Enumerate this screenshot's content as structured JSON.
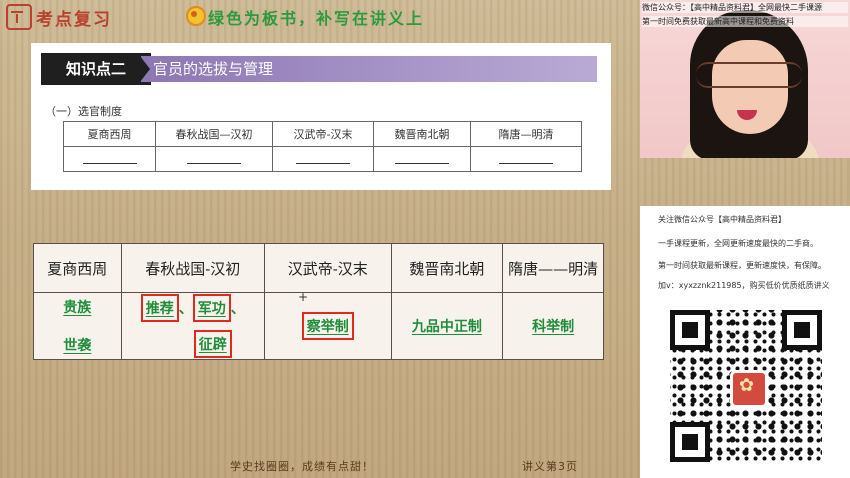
{
  "topbar": {
    "brand": "考点复习",
    "headline": "绿色为板书，补写在讲义上"
  },
  "card": {
    "tag": "知识点二",
    "title": "官员的选拔与管理",
    "subtitle": "（一）选官制度",
    "headers": [
      "夏商西周",
      "春秋战国—汉初",
      "汉武帝-汉末",
      "魏晋南北朝",
      "隋唐—明清"
    ]
  },
  "board": {
    "headers": [
      "夏商西周",
      "春秋战国-汉初",
      "汉武帝-汉末",
      "魏晋南北朝",
      "隋唐——明清"
    ],
    "col1": [
      "贵族",
      "世袭"
    ],
    "col2": [
      "推荐",
      "、",
      "军功",
      "、",
      "征辟"
    ],
    "col3": "察举制",
    "col4": "九品中正制",
    "col5": "科举制"
  },
  "bottom": {
    "left": "学史找圈圈，成绩有点甜！",
    "right": "讲义第3页"
  },
  "camera": {
    "line1": "微信公众号：【高中精品资料君】全网最快二手课源",
    "line2": "第一时间免费获取最新高中课程和免费资料"
  },
  "qr_panel": {
    "lines": [
      "关注微信公众号【高中精品资料君】",
      "一手课程更新，全网更新速度最快的二手商。",
      "第一时间获取最新课程，更新速度快，有保障。",
      "加v：xyxzznk211985，购买低价优质纸质讲义"
    ]
  },
  "colors": {
    "board_text": "#1f8d3a",
    "highlight_box": "#e02a1e",
    "kp_bar": "#8d77b4"
  }
}
